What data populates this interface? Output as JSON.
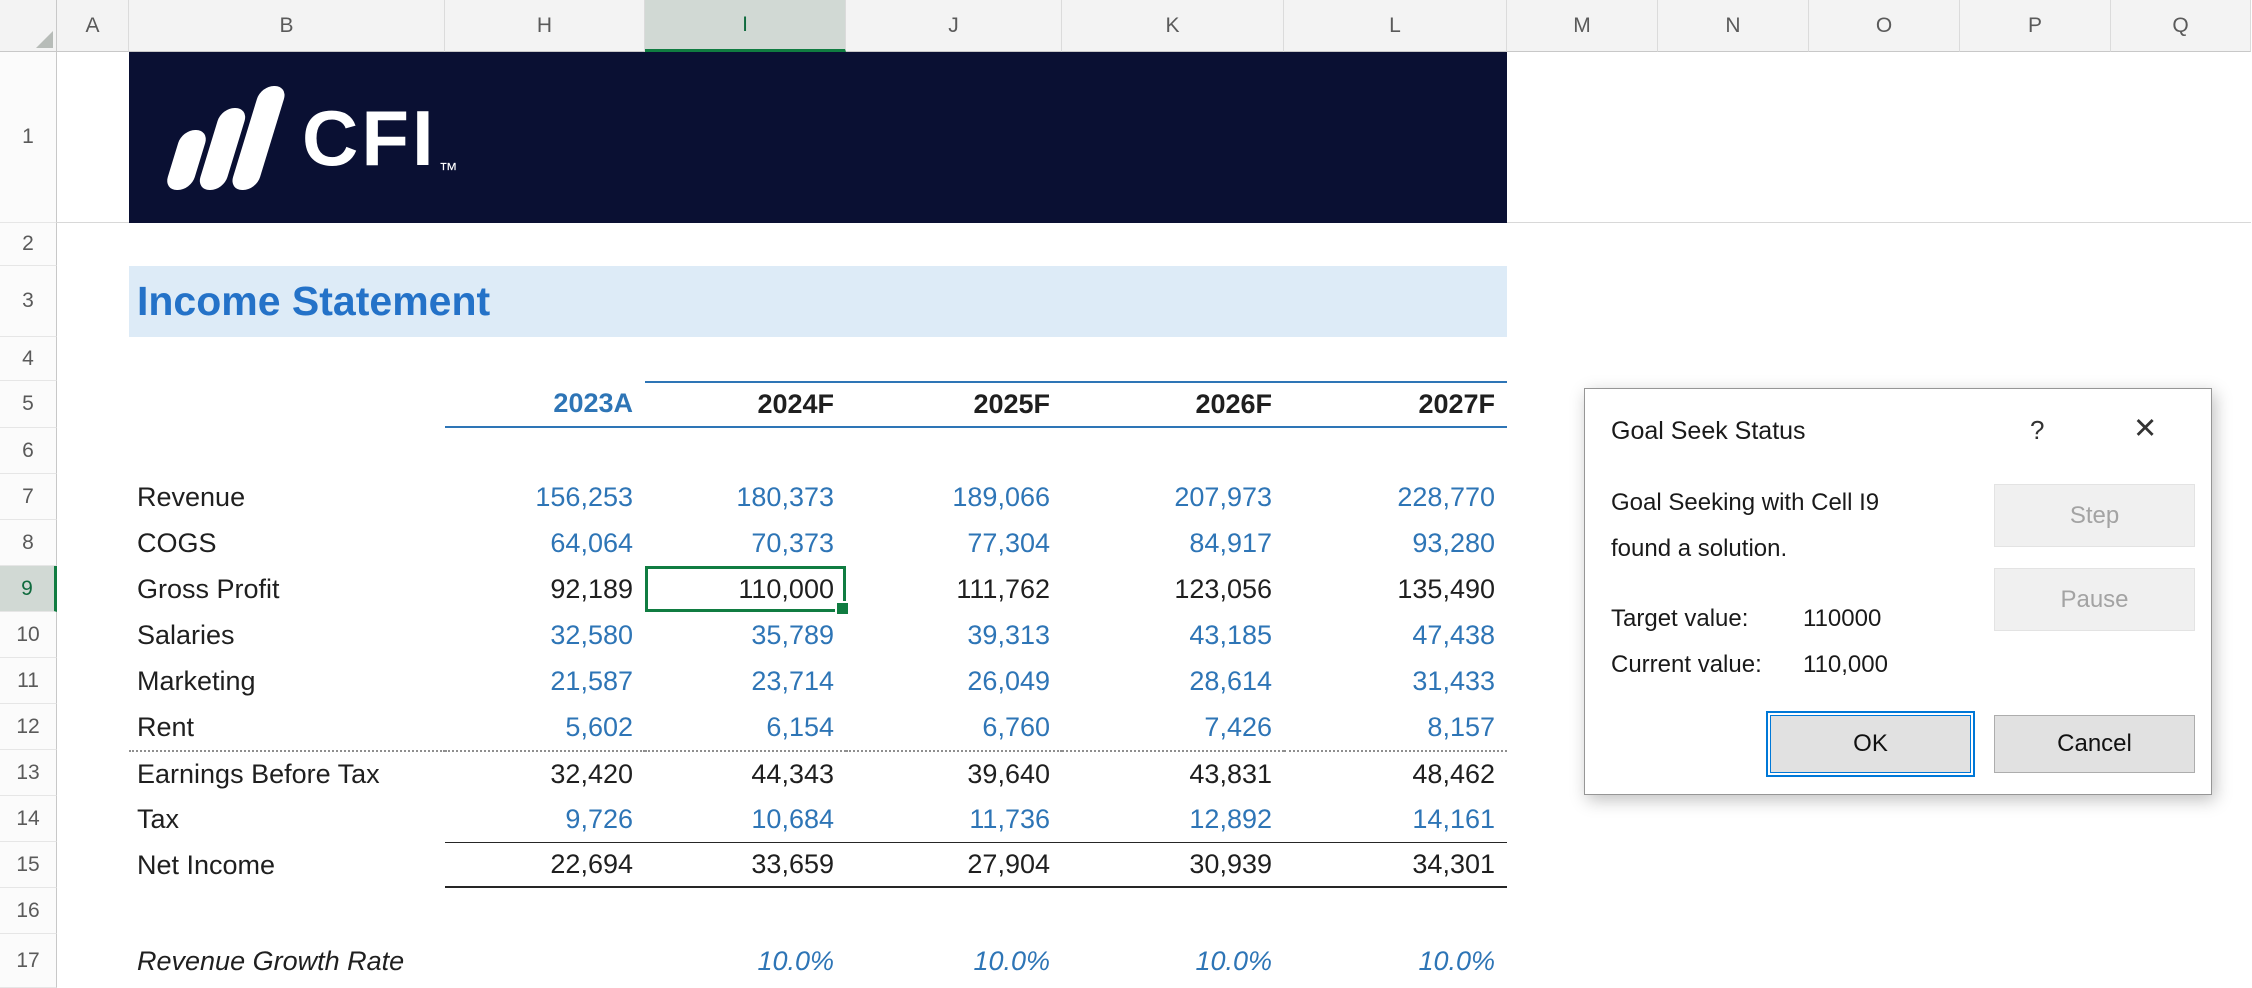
{
  "colors": {
    "selection_green": "#107c41",
    "input_blue": "#2e75b6",
    "banner_navy": "#0a1033",
    "title_blue": "#2472c8",
    "title_band_bg": "#ddebf7",
    "focus_blue": "#0078d7"
  },
  "columns": [
    "A",
    "B",
    "H",
    "I",
    "J",
    "K",
    "L",
    "M",
    "N",
    "O",
    "P",
    "Q"
  ],
  "row_numbers": [
    "1",
    "2",
    "3",
    "4",
    "5",
    "6",
    "7",
    "8",
    "9",
    "10",
    "11",
    "12",
    "13",
    "14",
    "15",
    "16",
    "17"
  ],
  "selection": {
    "active_cell": "I9"
  },
  "banner": {
    "logo_text": "CFI",
    "trademark": "™"
  },
  "sheet": {
    "title": "Income Statement",
    "years": [
      "2023A",
      "2024F",
      "2025F",
      "2026F",
      "2027F"
    ],
    "rows": [
      {
        "label": "Revenue",
        "kind": "input",
        "values": [
          "156,253",
          "180,373",
          "189,066",
          "207,973",
          "228,770"
        ]
      },
      {
        "label": "COGS",
        "kind": "input",
        "values": [
          "64,064",
          "70,373",
          "77,304",
          "84,917",
          "93,280"
        ]
      },
      {
        "label": "Gross Profit",
        "kind": "calc",
        "values": [
          "92,189",
          "110,000",
          "111,762",
          "123,056",
          "135,490"
        ]
      },
      {
        "label": "Salaries",
        "kind": "input",
        "values": [
          "32,580",
          "35,789",
          "39,313",
          "43,185",
          "47,438"
        ]
      },
      {
        "label": "Marketing",
        "kind": "input",
        "values": [
          "21,587",
          "23,714",
          "26,049",
          "28,614",
          "31,433"
        ]
      },
      {
        "label": "Rent",
        "kind": "input",
        "values": [
          "5,602",
          "6,154",
          "6,760",
          "7,426",
          "8,157"
        ]
      },
      {
        "label": "Earnings Before Tax",
        "kind": "calc",
        "values": [
          "32,420",
          "44,343",
          "39,640",
          "43,831",
          "48,462"
        ]
      },
      {
        "label": "Tax",
        "kind": "input",
        "values": [
          "9,726",
          "10,684",
          "11,736",
          "12,892",
          "14,161"
        ]
      },
      {
        "label": "Net Income",
        "kind": "calc",
        "values": [
          "22,694",
          "33,659",
          "27,904",
          "30,939",
          "34,301"
        ]
      }
    ],
    "growth": {
      "label": "Revenue Growth Rate",
      "values": [
        "10.0%",
        "10.0%",
        "10.0%",
        "10.0%"
      ]
    }
  },
  "dialog": {
    "title": "Goal Seek Status",
    "help": "?",
    "close": "✕",
    "message_line1": "Goal Seeking with Cell I9",
    "message_line2": "found a solution.",
    "target_label": "Target value:",
    "target_value": "110000",
    "current_label": "Current value:",
    "current_value": "110,000",
    "buttons": {
      "step": "Step",
      "pause": "Pause",
      "ok": "OK",
      "cancel": "Cancel"
    }
  }
}
